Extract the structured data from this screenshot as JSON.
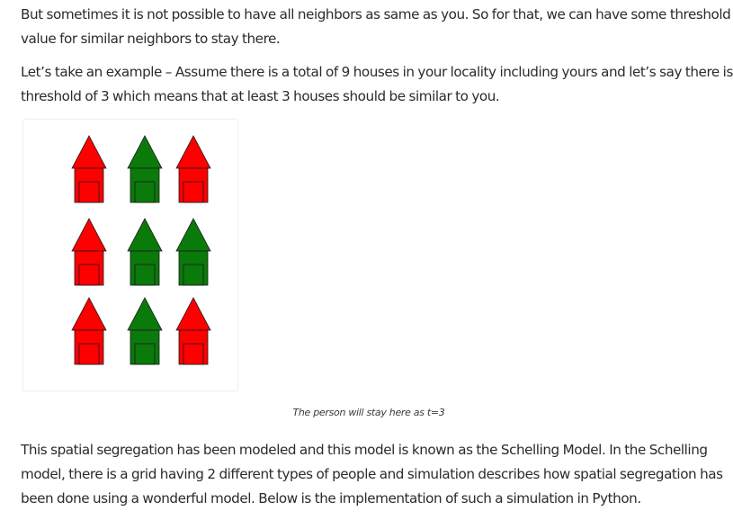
{
  "paragraphs": [
    {
      "lines": [
        "But sometimes it is not possible to have all neighbors as same as you. So for that, we can have some threshold",
        "value for similar neighbors to stay there."
      ]
    },
    {
      "lines": [
        "Let’s take an example – Assume there is a total of 9 houses in your locality including yours and let’s say there is a",
        "threshold of 3 which means that at least 3 houses should be similar to you."
      ]
    },
    {
      "lines": [
        "This spatial segregation has been modeled and this model is known as the Schelling Model. In the Schelling",
        "model, there is a grid having 2 different types of people and simulation describes how spatial segregation has",
        "been done using a wonderful model. Below is the implementation of such a simulation in Python."
      ]
    }
  ],
  "figure": {
    "caption": "The person will stay here as t=3",
    "colors": {
      "red": "#ff0000",
      "green": "#0a7a0a",
      "stroke": "#1a1a1a"
    },
    "houses": [
      [
        "red",
        "green",
        "red"
      ],
      [
        "red",
        "green",
        "green"
      ],
      [
        "red",
        "green",
        "red"
      ]
    ]
  }
}
